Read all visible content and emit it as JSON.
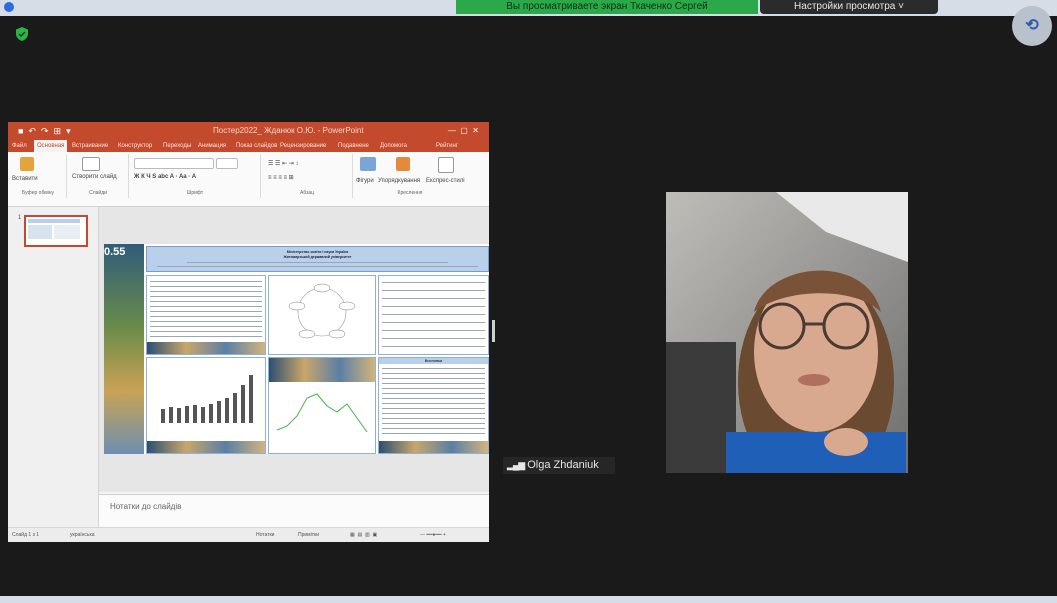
{
  "zoom": {
    "share_banner": "Вы просматриваете экран Ткаченко Сергей",
    "view_options": "Настройки просмотра ˅",
    "participant_name": "Olga Zhdaniuk",
    "colors": {
      "background": "#1a1a1a",
      "banner": "#2aa84a",
      "shield": "#29b34a"
    },
    "icons": [
      "shield-icon",
      "camera-switch-icon",
      "signal-icon"
    ]
  },
  "ppt": {
    "title": "Постер2022_ Жданюк О.Ю. - PowerPoint",
    "tabs": [
      "Файл",
      "Основная",
      "Встраивание",
      "Конструктор",
      "Переходы",
      "Анимация",
      "Показ слайдов",
      "Рецензирование",
      "Подавнене",
      "Допомога",
      "Рейтинг"
    ],
    "ribbon": {
      "paste": "Вставити",
      "new_slide": "Створити слайд",
      "clipboard": "Буфер обміну",
      "slides": "Слайди",
      "font": "Шрифт",
      "paragraph": "Абзац",
      "shapes": "Фігури",
      "arrange": "Упорядкування",
      "quick_styles": "Експрес-стилі",
      "drawing": "Креслення"
    },
    "slide_number": "1",
    "notes_placeholder": "Нотатки до слайдів",
    "status": {
      "slide": "Слайд 1 з 1",
      "language": "українська",
      "notes": "Нотатки",
      "comments": "Примітки"
    },
    "poster": {
      "header_line1": "Міністерство освіти і науки України",
      "header_line2": "Житомирський державний університет",
      "big_digits": "0.55",
      "conclusions": "Висновки"
    }
  }
}
